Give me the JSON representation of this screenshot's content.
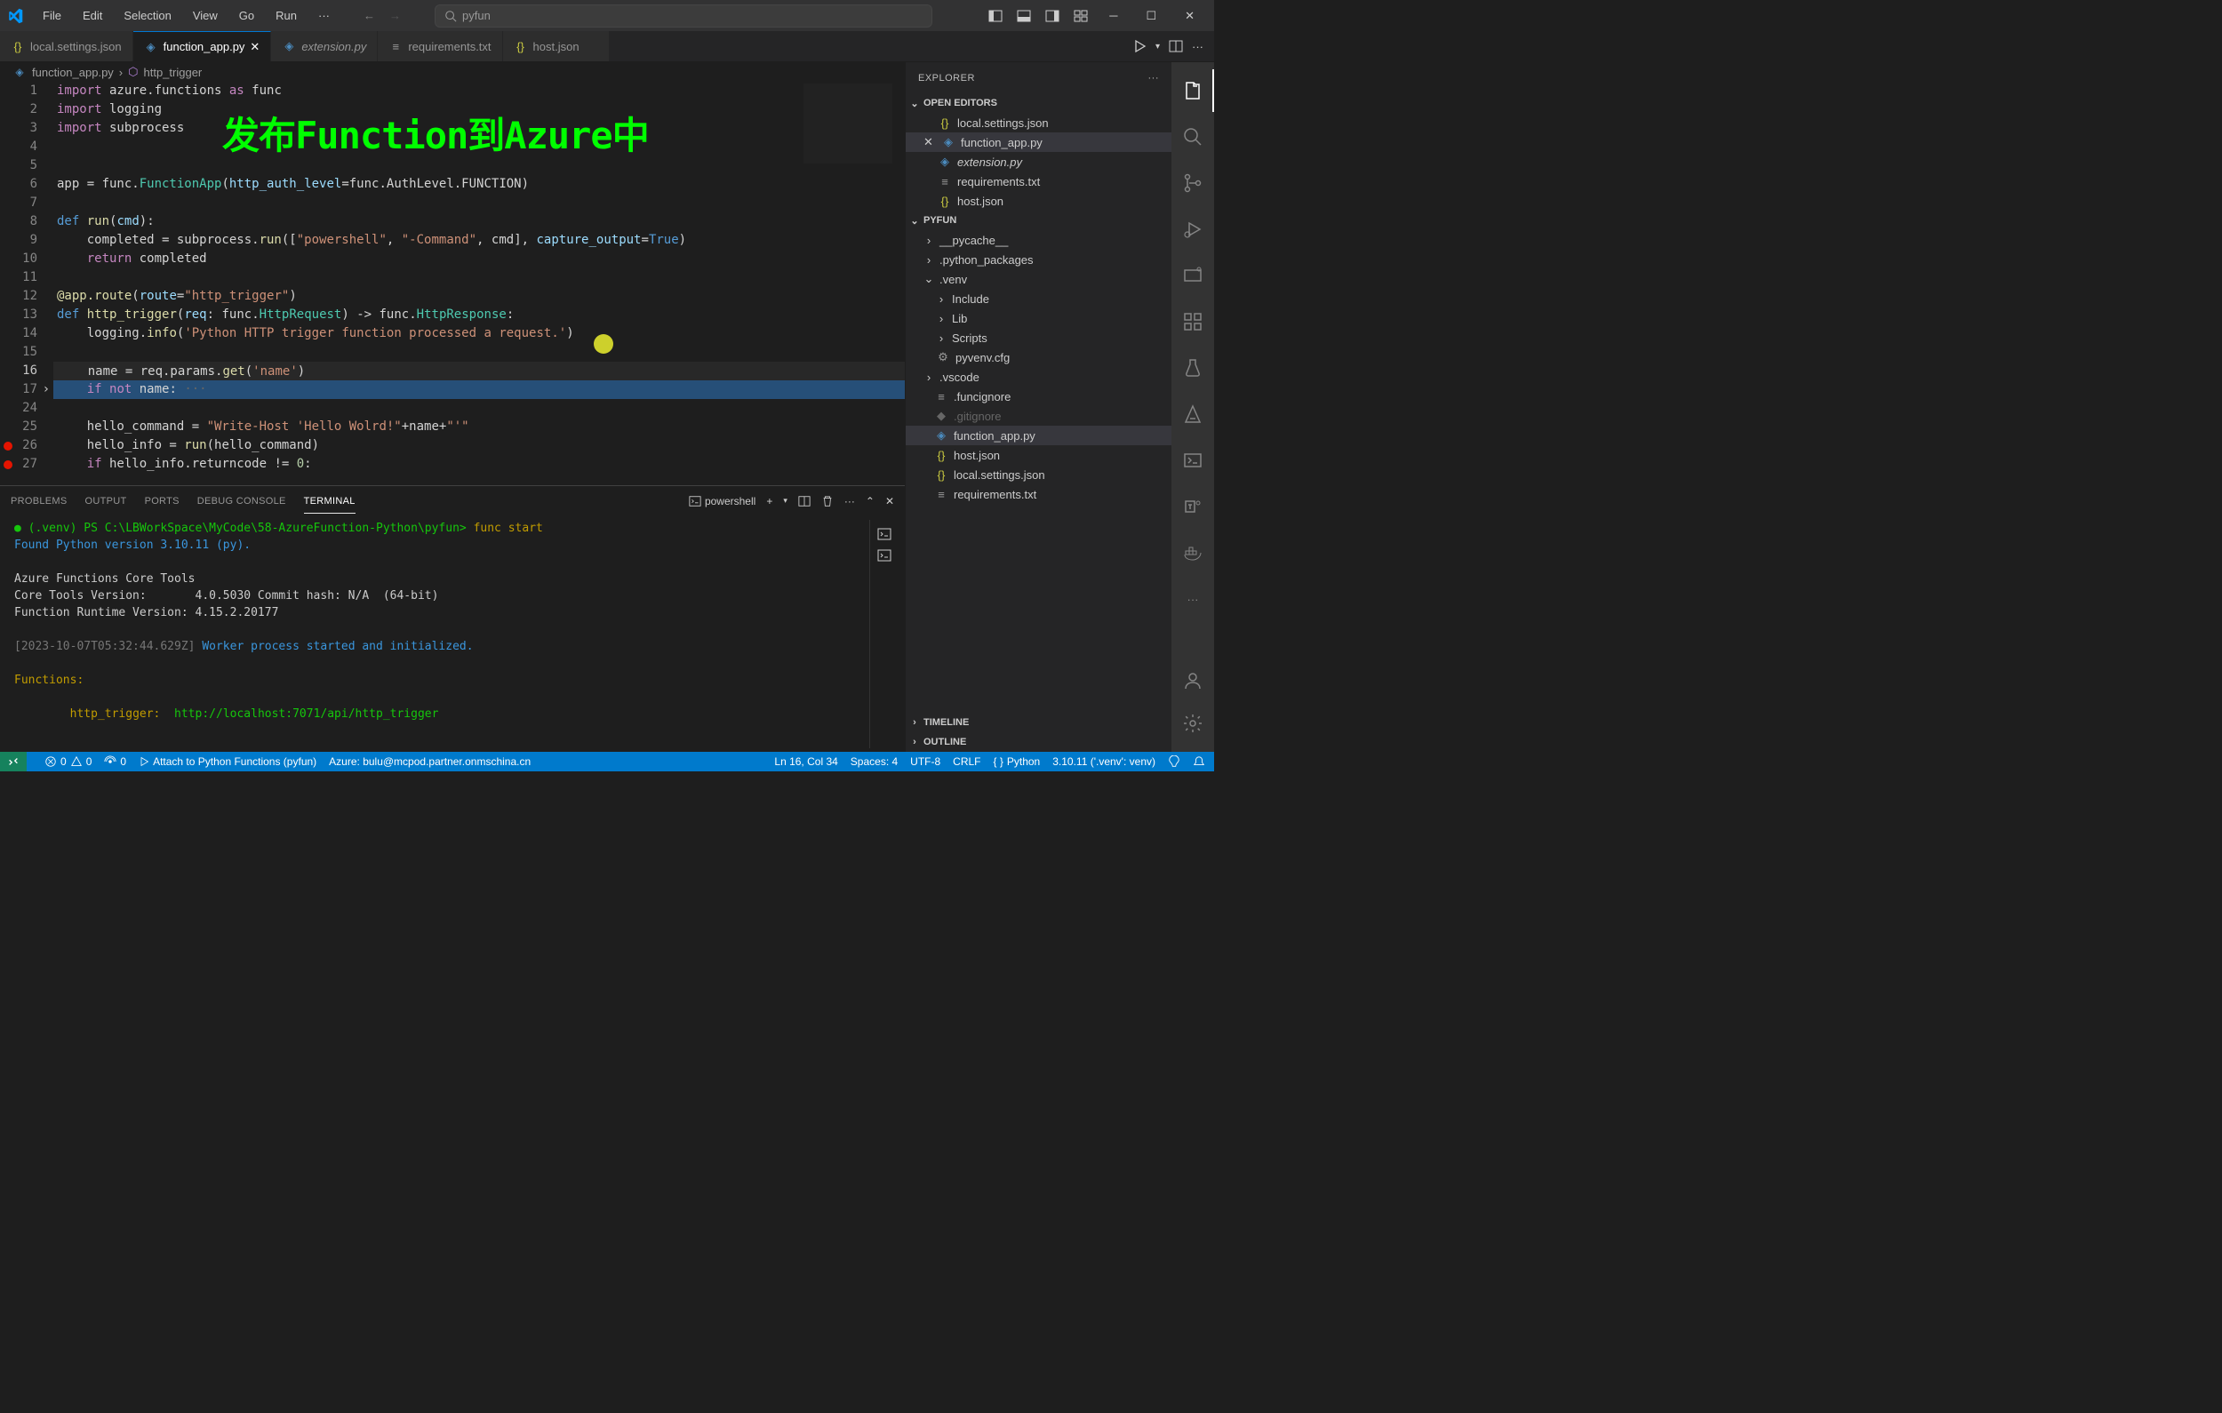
{
  "menu": {
    "file": "File",
    "edit": "Edit",
    "selection": "Selection",
    "view": "View",
    "go": "Go",
    "run": "Run"
  },
  "search": {
    "placeholder": "pyfun"
  },
  "tabs": [
    {
      "name": "local.settings.json",
      "icon": "json"
    },
    {
      "name": "function_app.py",
      "icon": "python",
      "active": true
    },
    {
      "name": "extension.py",
      "icon": "python",
      "italic": true
    },
    {
      "name": "requirements.txt",
      "icon": "text"
    },
    {
      "name": "host.json",
      "icon": "json"
    }
  ],
  "breadcrumb": {
    "file": "function_app.py",
    "symbol": "http_trigger"
  },
  "overlay": "发布Function到Azure中",
  "code_lines": [
    "1",
    "2",
    "3",
    "4",
    "5",
    "6",
    "7",
    "8",
    "9",
    "10",
    "11",
    "12",
    "13",
    "14",
    "15",
    "16",
    "17",
    "24",
    "25",
    "26",
    "27"
  ],
  "code": {
    "l1": "import azure.functions as func",
    "l2": "import logging",
    "l3": "import subprocess",
    "l6": "app = func.FunctionApp(http_auth_level=func.AuthLevel.FUNCTION)",
    "l8_a": "def",
    "l8_b": "run",
    "l8_c": "(cmd):",
    "l9": "    completed = subprocess.run([\"powershell\", \"-Command\", cmd], capture_output=True)",
    "l10": "    return completed",
    "l12": "@app.route(route=\"http_trigger\")",
    "l13": "def http_trigger(req: func.HttpRequest) -> func.HttpResponse:",
    "l14": "    logging.info('Python HTTP trigger function processed a request.')",
    "l16": "    name = req.params.get('name')",
    "l17": "    if not name: ···",
    "l25": "    hello_command = \"Write-Host 'Hello Wolrd!\"+name+\"'\"",
    "l26": "    hello_info = run(hello_command)",
    "l27": "    if hello_info.returncode != 0:"
  },
  "panel": {
    "tabs": {
      "problems": "PROBLEMS",
      "output": "OUTPUT",
      "ports": "PORTS",
      "debug": "DEBUG CONSOLE",
      "terminal": "TERMINAL"
    },
    "shell": "powershell"
  },
  "terminal": {
    "prompt": "(.venv) PS C:\\LBWorkSpace\\MyCode\\58-AzureFunction-Python\\pyfun>",
    "cmd": " func start",
    "l2": "Found Python version 3.10.11 (py).",
    "l4": "Azure Functions Core Tools",
    "l5": "Core Tools Version:       4.0.5030 Commit hash: N/A  (64-bit)",
    "l6": "Function Runtime Version: 4.15.2.20177",
    "l8a": "[2023-10-07T05:32:44.629Z] ",
    "l8b": "Worker process started and initialized.",
    "l10": "Functions:",
    "l12a": "        http_trigger: ",
    "l12b": " http://localhost:7071/api/http_trigger"
  },
  "explorer": {
    "title": "EXPLORER",
    "sections": {
      "open_editors": "OPEN EDITORS",
      "project": "PYFUN",
      "timeline": "TIMELINE",
      "outline": "OUTLINE"
    },
    "open_editors": [
      {
        "name": "local.settings.json",
        "icon": "json"
      },
      {
        "name": "function_app.py",
        "icon": "python",
        "active": true
      },
      {
        "name": "extension.py",
        "icon": "python"
      },
      {
        "name": "requirements.txt",
        "icon": "text"
      },
      {
        "name": "host.json",
        "icon": "json"
      }
    ],
    "tree": {
      "pycache": "__pycache__",
      "pypkg": ".python_packages",
      "venv": ".venv",
      "include": "Include",
      "lib": "Lib",
      "scripts": "Scripts",
      "pyvenv": "pyvenv.cfg",
      "vscode": ".vscode",
      "funcignore": ".funcignore",
      "gitignore": ".gitignore",
      "funcapp": "function_app.py",
      "hostjson": "host.json",
      "localsettings": "local.settings.json",
      "requirements": "requirements.txt"
    }
  },
  "statusbar": {
    "errors": "0",
    "warnings": "0",
    "ports": "0",
    "attach": "Attach to Python Functions (pyfun)",
    "azure": "Azure: bulu@mcpod.partner.onmschina.cn",
    "pos": "Ln 16, Col 34",
    "spaces": "Spaces: 4",
    "encoding": "UTF-8",
    "eol": "CRLF",
    "lang": "Python",
    "python": "3.10.11 ('.venv': venv)"
  }
}
